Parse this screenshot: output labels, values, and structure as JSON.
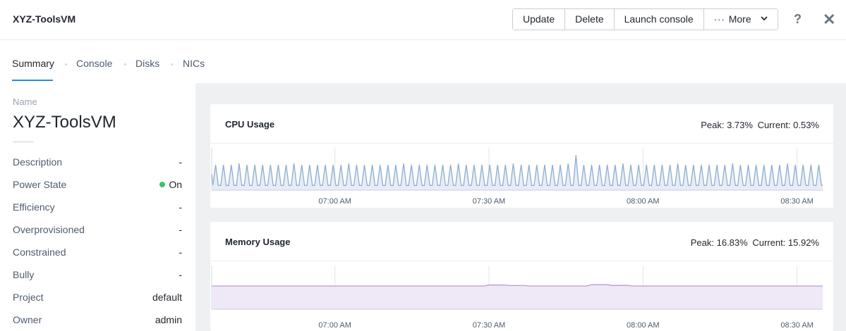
{
  "header": {
    "vm_name": "XYZ-ToolsVM",
    "buttons": {
      "update": "Update",
      "delete": "Delete",
      "launch_console": "Launch console",
      "more_dots": "···",
      "more": "More"
    },
    "help_glyph": "?",
    "close_glyph": "✕"
  },
  "tabs": [
    "Summary",
    "Console",
    "Disks",
    "NICs"
  ],
  "active_tab": "Summary",
  "summary": {
    "name_label": "Name",
    "name_value": "XYZ-ToolsVM",
    "properties": [
      {
        "key": "Description",
        "value": "-"
      },
      {
        "key": "Power State",
        "value": "On"
      },
      {
        "key": "Efficiency",
        "value": "-"
      },
      {
        "key": "Overprovisioned",
        "value": "-"
      },
      {
        "key": "Constrained",
        "value": "-"
      },
      {
        "key": "Bully",
        "value": "-"
      },
      {
        "key": "Project",
        "value": "default"
      },
      {
        "key": "Owner",
        "value": "admin"
      }
    ]
  },
  "colors": {
    "accent": "#2b8ad6",
    "power_on": "#3fc16b",
    "cpu_line": "#8faed3",
    "cpu_fill": "#e6edf6",
    "memory_line": "#b99bd4",
    "memory_fill": "#efe8f6"
  },
  "icons": {
    "help": "help-icon",
    "close": "close-icon",
    "more_caret": "chevron-down-icon"
  },
  "chart_data": [
    {
      "type": "area",
      "title": "CPU Usage",
      "peak_label": "Peak: 3.73%",
      "current_label": "Current: 0.53%",
      "x_ticks": [
        "07:00 AM",
        "07:30 AM",
        "08:00 AM",
        "08:30 AM"
      ],
      "x_range": [
        "06:36 AM",
        "08:35 AM"
      ],
      "series": [
        {
          "baseline": 0.5,
          "spike_value": 2.7,
          "spikes": 78,
          "peak": 3.73,
          "peak_at": "07:47 AM",
          "current": 0.53
        }
      ],
      "ylim": [
        0,
        4.5
      ],
      "grid": "vertical"
    },
    {
      "type": "area",
      "title": "Memory Usage",
      "peak_label": "Peak: 16.83%",
      "current_label": "Current: 15.92%",
      "x_ticks": [
        "07:00 AM",
        "07:30 AM",
        "08:00 AM",
        "08:30 AM"
      ],
      "x_range": [
        "06:36 AM",
        "08:35 AM"
      ],
      "series": [
        {
          "baseline": 15.9,
          "bumps": [
            {
              "at": "07:31 AM",
              "value": 16.6
            },
            {
              "at": "07:51 AM",
              "value": 16.83
            }
          ],
          "peak": 16.83,
          "current": 15.92
        }
      ],
      "ylim": [
        0,
        30
      ],
      "grid": "vertical"
    }
  ]
}
